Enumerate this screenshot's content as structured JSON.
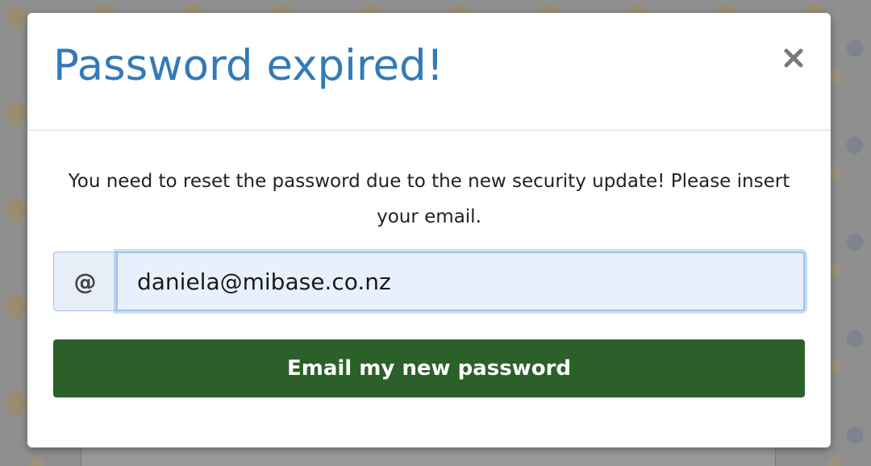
{
  "modal": {
    "title": "Password expired!",
    "close_icon": "close-icon",
    "message": "You need to reset the password due to the new security update! Please insert your email.",
    "email_addon": "@",
    "email_value": "daniela@mibase.co.nz",
    "submit_label": "Email my new password"
  },
  "colors": {
    "title": "#337ab7",
    "submit_button": "#2b6129",
    "input_background": "#e8f0fe"
  }
}
